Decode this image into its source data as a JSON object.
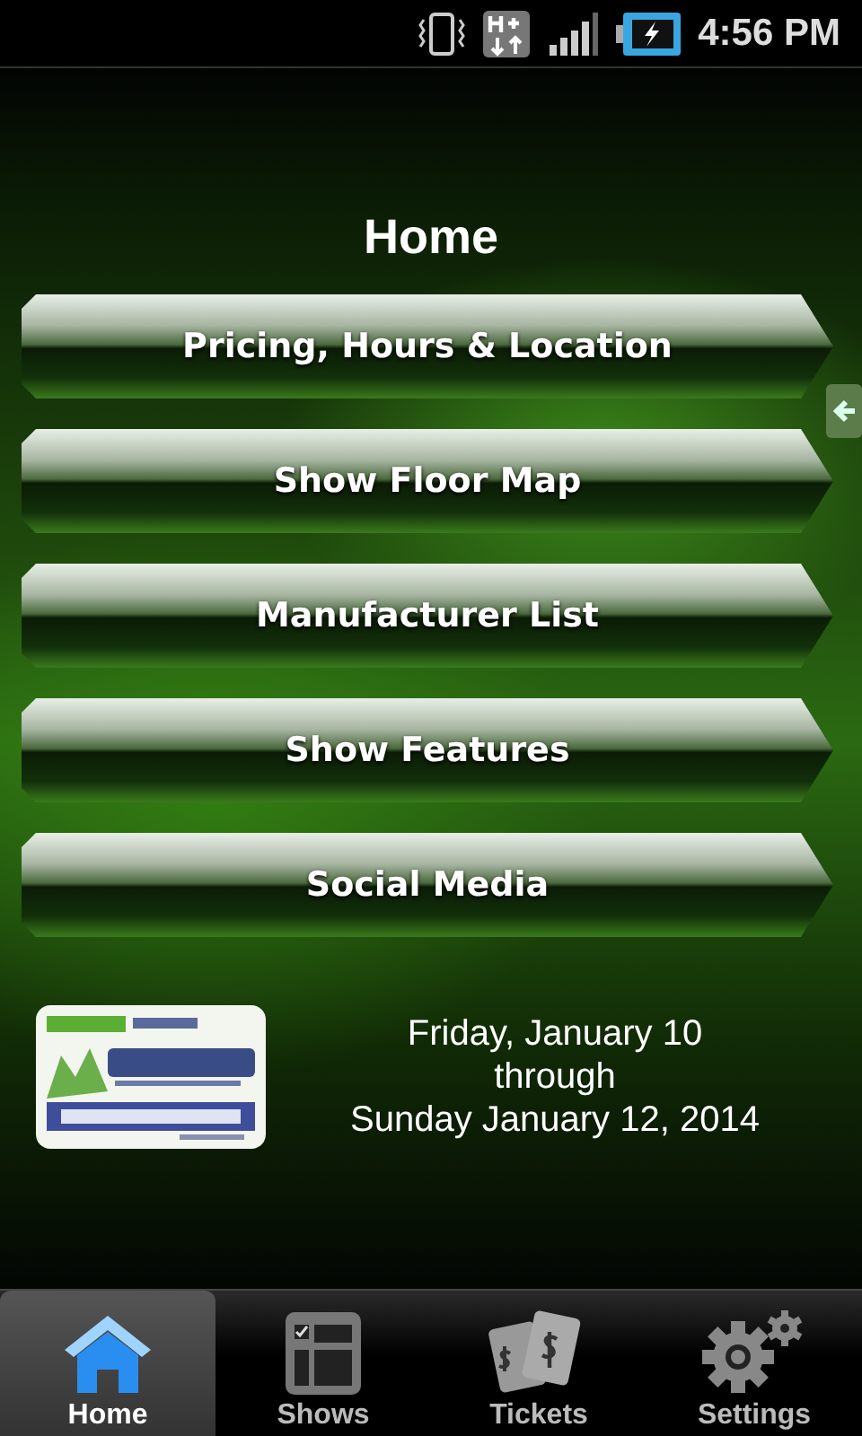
{
  "status_bar": {
    "time": "4:56 PM"
  },
  "title": "Home",
  "menu": [
    {
      "label": "Pricing, Hours & Location"
    },
    {
      "label": "Show Floor Map"
    },
    {
      "label": "Manufacturer List"
    },
    {
      "label": "Show Features"
    },
    {
      "label": "Social Media"
    }
  ],
  "event": {
    "logo": {
      "kind": "picture"
    },
    "dates": [
      "Friday, January 10",
      "through",
      "Sunday January 12, 2014"
    ]
  },
  "tabs": [
    {
      "label": "Home",
      "kind": "home",
      "selected": true
    },
    {
      "label": "Shows",
      "kind": "grid",
      "selected": false
    },
    {
      "label": "Tickets",
      "kind": "tickets",
      "selected": false
    },
    {
      "label": "Settings",
      "kind": "gears",
      "selected": false
    }
  ]
}
